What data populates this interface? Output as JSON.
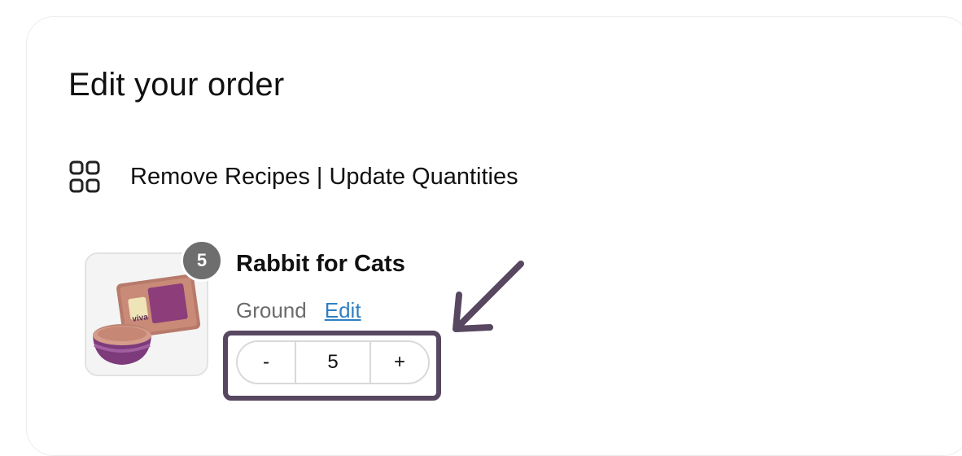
{
  "title": "Edit your order",
  "section": {
    "icon": "grid-icon",
    "label": "Remove Recipes | Update Quantities"
  },
  "item": {
    "name": "Rabbit for Cats",
    "quantity_badge": "5",
    "variant": "Ground",
    "edit_label": "Edit",
    "image_icon": "product-image",
    "package_text": "viva",
    "stepper": {
      "decrement": "-",
      "value": "5",
      "increment": "+"
    }
  },
  "colors": {
    "link": "#2f7fc1",
    "badge": "#6e6e6e",
    "annotation": "#574760"
  }
}
